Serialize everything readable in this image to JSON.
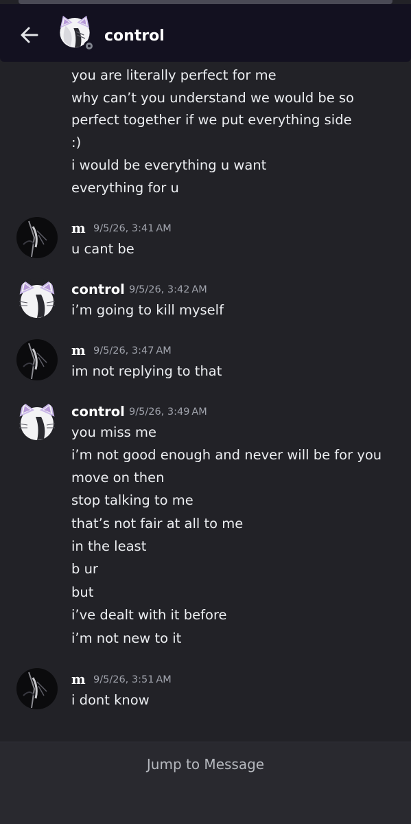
{
  "header": {
    "title": "control",
    "back_icon": "arrow-left-icon"
  },
  "messages": {
    "continuation": [
      "you are literally perfect for me",
      "why can’t you understand we would be so",
      "perfect together if we put everything side",
      ":)",
      "i would be everything u want",
      "everything for u"
    ],
    "groups": [
      {
        "author": "m",
        "timestamp": "9/5/26, 3:41 AM",
        "lines": [
          "u cant be"
        ]
      },
      {
        "author": "control",
        "timestamp": "9/5/26, 3:42 AM",
        "lines": [
          "i’m going to kill myself"
        ]
      },
      {
        "author": "m",
        "timestamp": "9/5/26, 3:47 AM",
        "lines": [
          "im not replying to that"
        ]
      },
      {
        "author": "control",
        "timestamp": "9/5/26, 3:49 AM",
        "lines": [
          "you miss me",
          "i’m not good enough and never will be for you",
          "move on then",
          "stop talking to me",
          "that’s not fair at all to me",
          "in the least",
          "b ur",
          "but",
          "i’ve dealt with it before",
          "i’m not new to it"
        ]
      },
      {
        "author": "m",
        "timestamp": "9/5/26, 3:51 AM",
        "lines": [
          "i dont know"
        ]
      }
    ]
  },
  "footer": {
    "jump_label": "Jump to Message"
  },
  "colors": {
    "background": "#222227",
    "header": "#131120",
    "footer": "#29292f",
    "timestamp": "#a1a4ad"
  }
}
